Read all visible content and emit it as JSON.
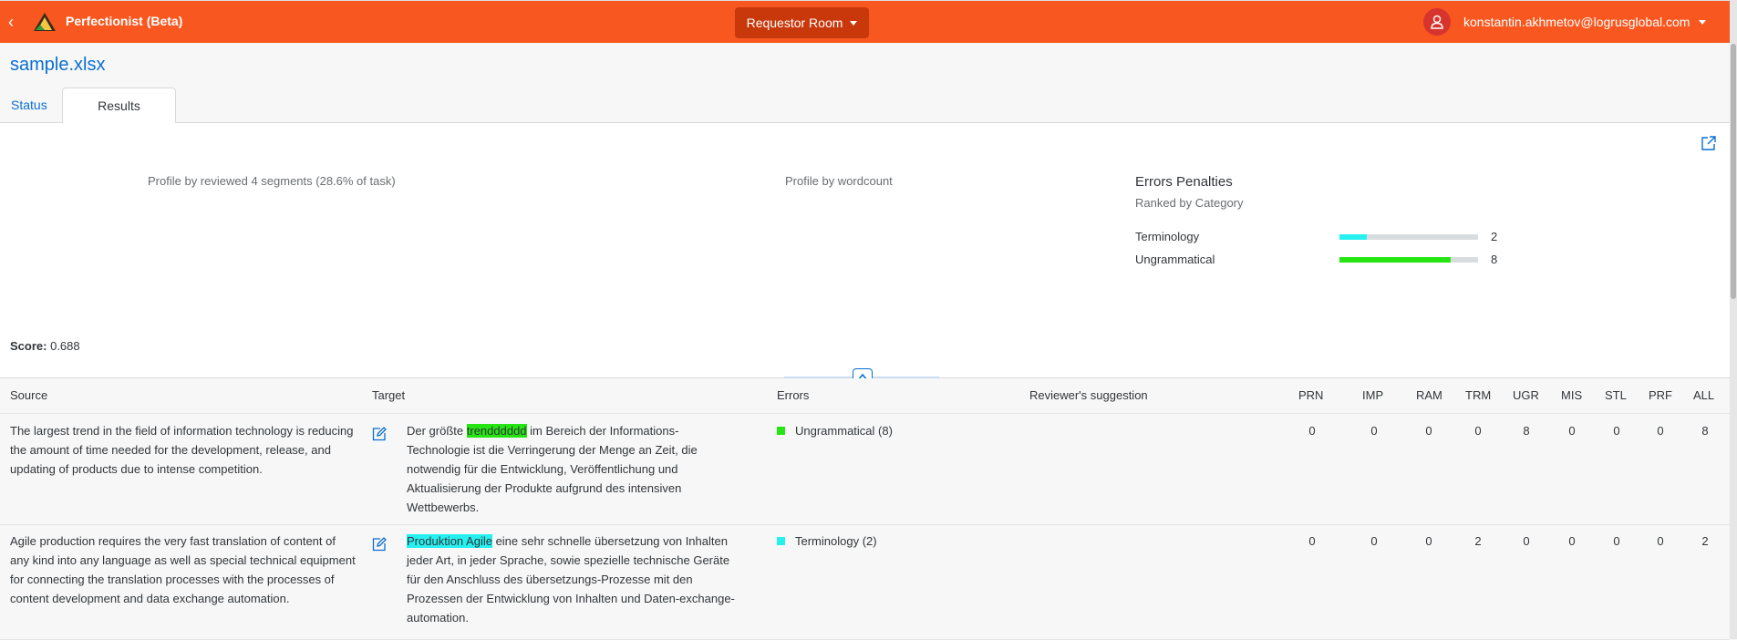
{
  "shell": {
    "app_title": "Perfectionist (Beta)",
    "room_label": "Requestor Room",
    "user_email": "konstantin.akhmetov@logrusglobal.com"
  },
  "file_title": "sample.xlsx",
  "tabs": [
    {
      "label": "Status",
      "selected": false
    },
    {
      "label": "Results",
      "selected": true
    }
  ],
  "profile": {
    "reviewed_text": "Profile by reviewed 4 segments (28.6% of task)",
    "wordcount_text": "Profile by wordcount"
  },
  "penalties": {
    "title": "Errors Penalties",
    "subtitle": "Ranked by Category",
    "items": [
      {
        "label": "Terminology",
        "value": "2",
        "fraction": 0.2,
        "color": "#27f0f0"
      },
      {
        "label": "Ungrammatical",
        "value": "8",
        "fraction": 0.8,
        "color": "#25e612"
      }
    ]
  },
  "score": {
    "label": "Score:",
    "value": "0.688"
  },
  "table": {
    "headers": {
      "source": "Source",
      "target": "Target",
      "errors": "Errors",
      "suggestion": "Reviewer's suggestion",
      "prn": "PRN",
      "imp": "IMP",
      "ram": "RAM",
      "trm": "TRM",
      "ugr": "UGR",
      "mis": "MIS",
      "stl": "STL",
      "prf": "PRF",
      "all": "ALL"
    },
    "rows": [
      {
        "source": "The largest trend in the field of information technology is reducing the amount of time needed for the development, release, and updating of products due to intense competition.",
        "target_pre": "Der größte ",
        "target_hl": "trendddddd",
        "target_post": " im Bereich der Informations-Technologie ist die Verringerung der Menge an Zeit, die notwendig für die Entwicklung, Veröffentlichung und Aktualisierung der Produkte aufgrund des intensiven Wettbewerbs.",
        "error_label": "Ungrammatical (8)",
        "error_color": "#25e612",
        "prn": "0",
        "imp": "0",
        "ram": "0",
        "trm": "0",
        "ugr": "8",
        "mis": "0",
        "stl": "0",
        "prf": "0",
        "all": "8"
      },
      {
        "source": "Agile production requires the very fast translation of content of any kind into any language as well as special technical equipment for connecting the translation processes with the processes of content development and data exchange automation.",
        "target_pre": "",
        "target_hl": "Produktion Agile",
        "target_post": "  eine sehr schnelle übersetzung von Inhalten jeder Art, in jeder Sprache, sowie spezielle technische Geräte für den Anschluss des übersetzungs-Prozesse mit den Prozessen der Entwicklung von Inhalten und Daten-exchange-automation.",
        "error_label": "Terminology (2)",
        "error_color": "#27f0f0",
        "prn": "0",
        "imp": "0",
        "ram": "0",
        "trm": "2",
        "ugr": "0",
        "mis": "0",
        "stl": "0",
        "prf": "0",
        "all": "2"
      }
    ]
  },
  "icons": {
    "back": "chevron-left-icon",
    "logo": "app-logo-icon",
    "user": "person-icon",
    "export": "export-icon",
    "edit": "edit-icon",
    "collapse": "collapse-up-icon"
  }
}
